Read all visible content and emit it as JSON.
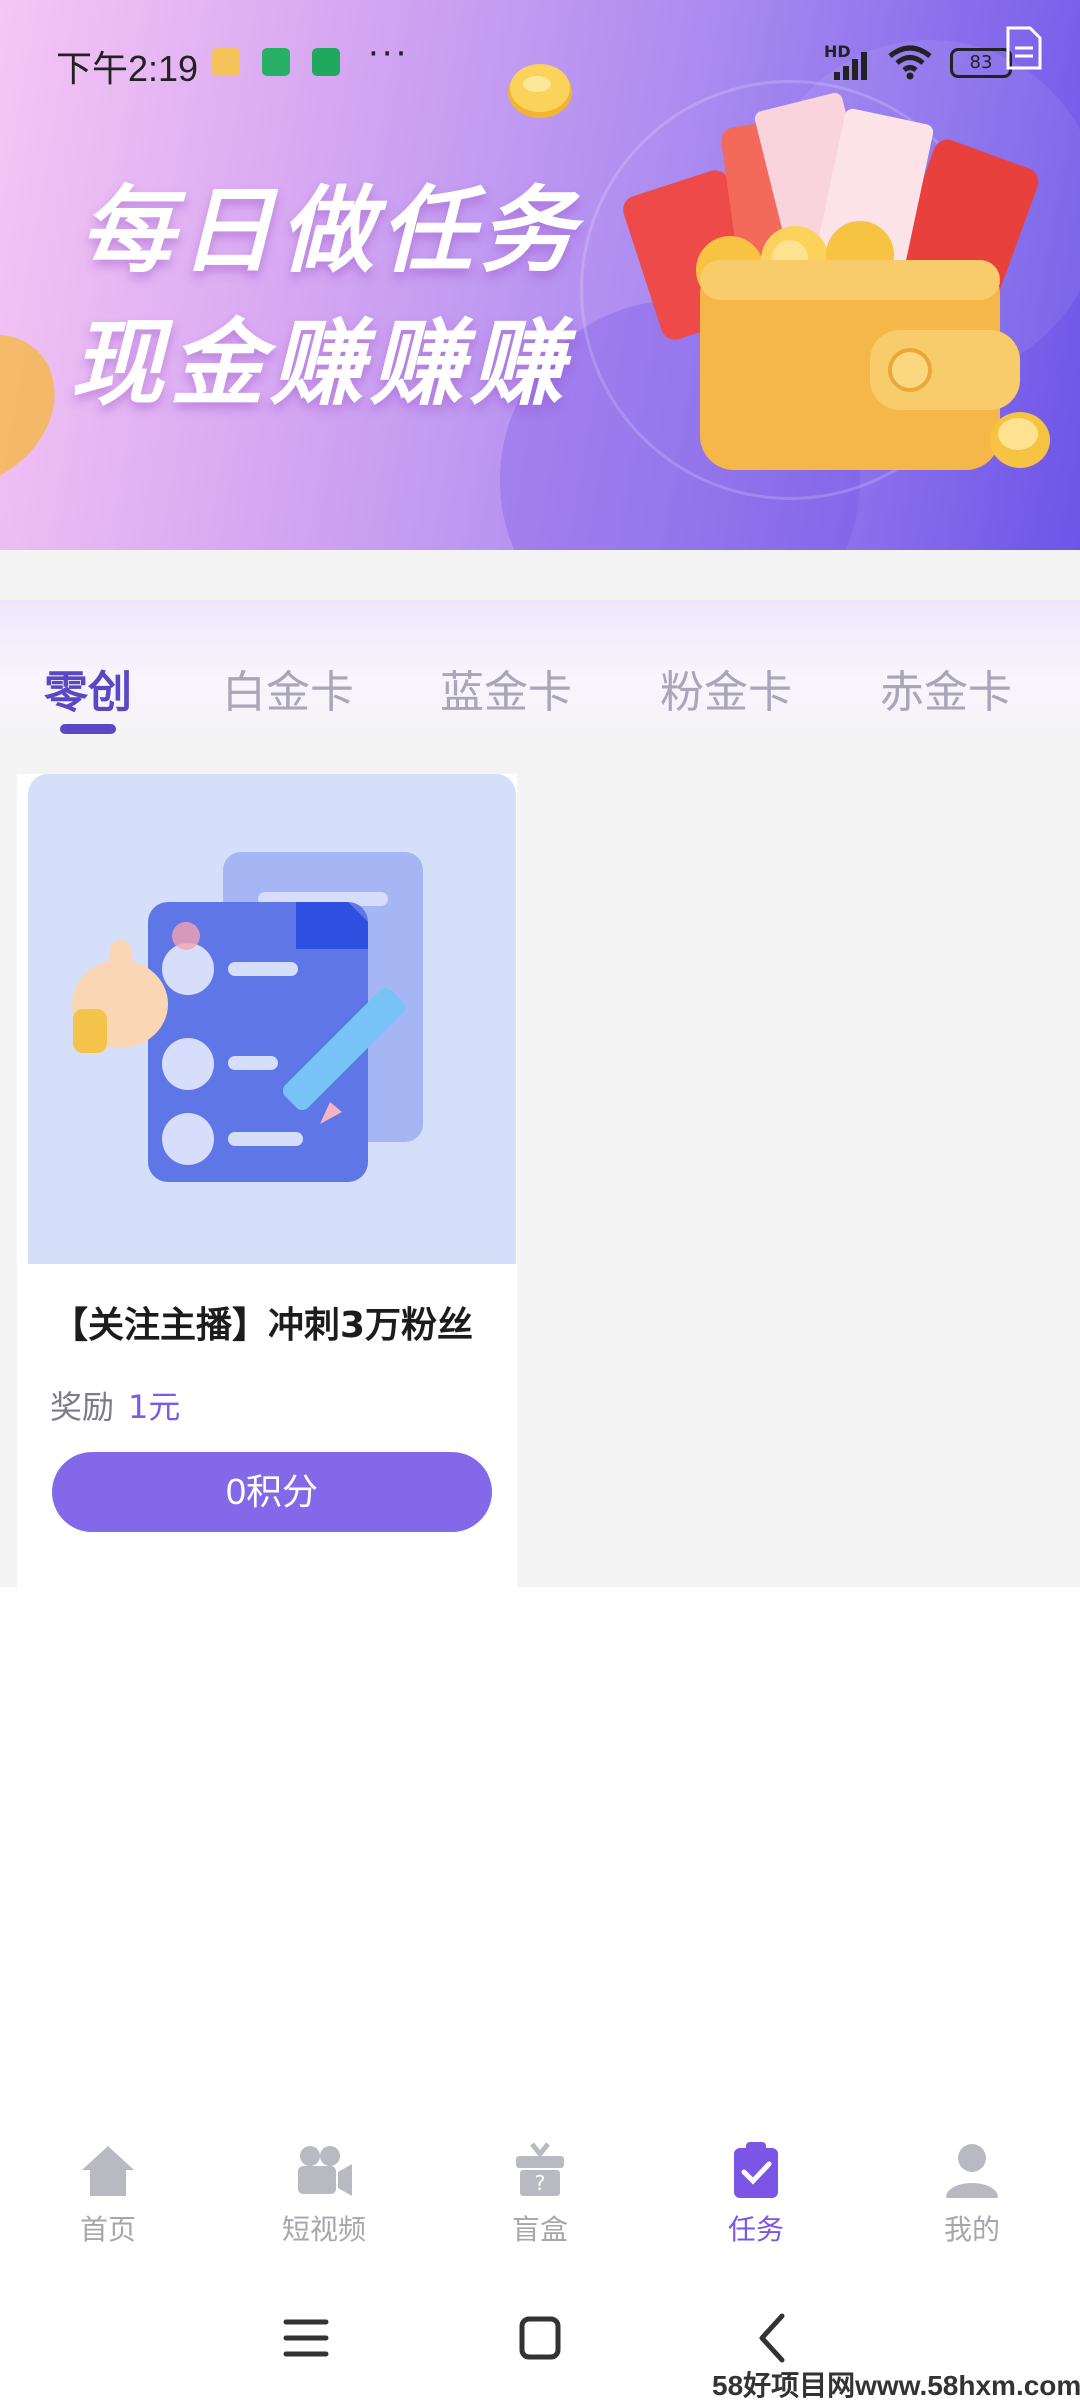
{
  "status_bar": {
    "time": "下午2:19",
    "more": "···",
    "network": "HD",
    "battery": "83"
  },
  "banner": {
    "title": "每日做任务",
    "subtitle": "现金赚赚赚"
  },
  "tabs": [
    {
      "label": "零创",
      "active": true
    },
    {
      "label": "白金卡",
      "active": false
    },
    {
      "label": "蓝金卡",
      "active": false
    },
    {
      "label": "粉金卡",
      "active": false
    },
    {
      "label": "赤金卡",
      "active": false
    }
  ],
  "task_card": {
    "title": "【关注主播】冲刺3万粉丝",
    "reward_label": "奖励",
    "reward_value": "1元",
    "button_label": "0积分"
  },
  "bottom_nav": [
    {
      "label": "首页",
      "icon": "home-icon",
      "active": false
    },
    {
      "label": "短视频",
      "icon": "video-camera-icon",
      "active": false
    },
    {
      "label": "盲盒",
      "icon": "mystery-box-icon",
      "active": false
    },
    {
      "label": "任务",
      "icon": "task-clipboard-icon",
      "active": true
    },
    {
      "label": "我的",
      "icon": "user-icon",
      "active": false
    }
  ],
  "system_nav": [
    "menu-icon",
    "home-square-icon",
    "back-icon"
  ],
  "watermark": "58好项目网www.58hxm.com",
  "colors": {
    "accent": "#7a55e6",
    "tab_active": "#5b47c4",
    "button": "#8468ea",
    "page_bg": "#f4f4f5"
  }
}
